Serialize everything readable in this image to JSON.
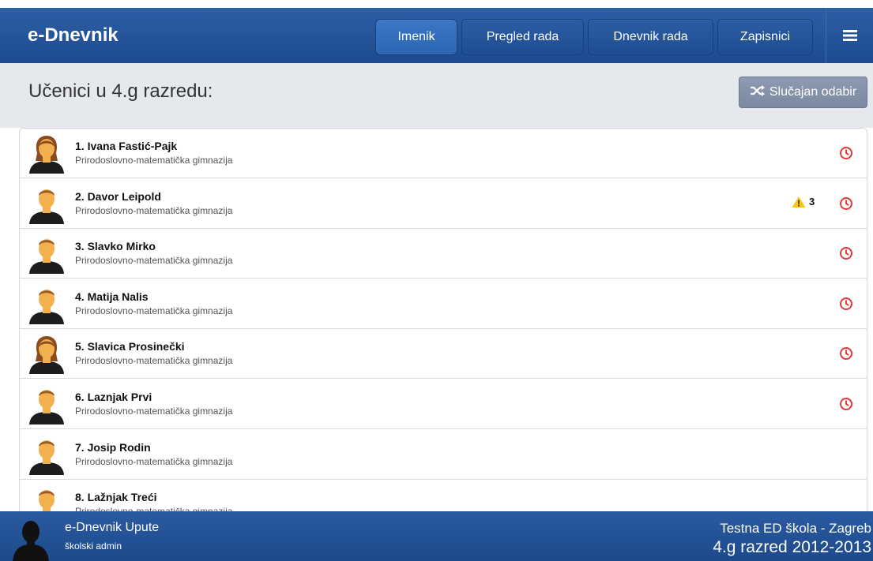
{
  "header": {
    "brand": "e-Dnevnik",
    "nav": [
      "Imenik",
      "Pregled rada",
      "Dnevnik rada",
      "Zapisnici"
    ],
    "menu_icon": "hamburger-menu-icon"
  },
  "page": {
    "title": "Učenici u 4.g razredu:",
    "random_button": "Slučajan odabir",
    "random_icon": "shuffle-icon"
  },
  "students": [
    {
      "name": "1. Ivana Fastić-Pajk",
      "school": "Prirodoslovno-matematička gimnazija",
      "gender": "female",
      "warnings": "",
      "clock": true
    },
    {
      "name": "2. Davor Leipold",
      "school": "Prirodoslovno-matematička gimnazija",
      "gender": "male",
      "warnings": "3",
      "clock": true
    },
    {
      "name": "3. Slavko Mirko",
      "school": "Prirodoslovno-matematička gimnazija",
      "gender": "male",
      "warnings": "",
      "clock": true
    },
    {
      "name": "4. Matija Nalis",
      "school": "Prirodoslovno-matematička gimnazija",
      "gender": "male",
      "warnings": "",
      "clock": true
    },
    {
      "name": "5. Slavica Prosinečki",
      "school": "Prirodoslovno-matematička gimnazija",
      "gender": "female",
      "warnings": "",
      "clock": true
    },
    {
      "name": "6. Laznjak Prvi",
      "school": "Prirodoslovno-matematička gimnazija",
      "gender": "male",
      "warnings": "",
      "clock": true
    },
    {
      "name": "7. Josip Rodin",
      "school": "Prirodoslovno-matematička gimnazija",
      "gender": "male",
      "warnings": "",
      "clock": false
    },
    {
      "name": "8. Lažnjak Treći",
      "school": "Prirodoslovno-matematička gimnazija",
      "gender": "male",
      "warnings": "",
      "clock": false
    }
  ],
  "footer": {
    "title": "e-Dnevnik Upute",
    "role": "školski admin",
    "school": "Testna ED škola - Zagreb",
    "class": "4.g razred 2012-2013"
  },
  "colors": {
    "nav_bg": "#2d5fa6",
    "active_nav": "#3b77c6",
    "clock_red": "#e5383b",
    "warning_yellow": "#f5c518"
  }
}
